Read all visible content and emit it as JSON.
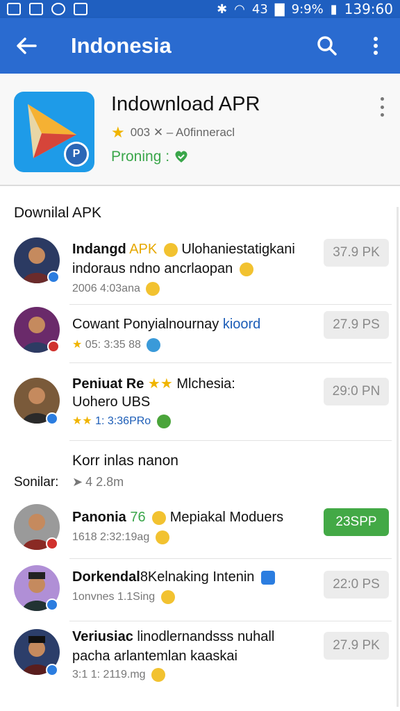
{
  "status_bar": {
    "icons_left": [
      "ha",
      "notify",
      "camera",
      "mail"
    ],
    "battery": "9:9%",
    "signal_text": "43",
    "time": "139:60"
  },
  "app_bar": {
    "back_icon": "arrow-left-icon",
    "title": "Indonesia",
    "search_icon": "search-icon",
    "more_icon": "more-vert-icon"
  },
  "app_card": {
    "logo_badge": "P",
    "name": "Indownload APR",
    "rating_text": "003 ✕ – A0finneracl",
    "status_text": "Proning :",
    "status_icon": "heart-check-icon"
  },
  "list": {
    "section_title": "Downilal APK",
    "mid_label": "Korr inlas nanon",
    "mid_side_label": "Sonilar:",
    "mid_meta": "4 2.8m",
    "rows": [
      {
        "title_bold": "Indangd",
        "title_accent": "APK",
        "title_rest": "Ulohaniestatigkani",
        "line2": "indoraus ndno ancrlaopan",
        "line3": "2006 4:03ana",
        "size": "37.9 PK",
        "active": false
      },
      {
        "title_bold": "Cowant",
        "title_accent": "Ponyialnournay",
        "title_rest": "kioord",
        "line2": "",
        "line3": "05: 3:35 88",
        "size": "27.9 PS",
        "active": false
      },
      {
        "title_bold": "Peniuat Re",
        "title_accent": "",
        "title_rest": "Mlchesia:",
        "line2": "Uohero UBS",
        "line3": "1: 3:36PRo",
        "size": "29:0 PN",
        "active": false
      },
      {
        "title_bold": "Panonia",
        "title_accent": "76",
        "title_rest": "Mepiakal Moduers",
        "line2": "",
        "line3": "1618 2:32:19ag",
        "size": "23SPP",
        "active": true
      },
      {
        "title_bold": "Dorkendal",
        "title_accent": "",
        "title_rest": "8Kelnaking Intenin",
        "line2": "",
        "line3": "1onvnes 1.1Sing",
        "size": "22:0 PS",
        "active": false
      },
      {
        "title_bold": "Veriusiac",
        "title_accent": "",
        "title_rest": "linodlernandsss nuhall",
        "line2": "pacha arlantemlan kaaskai",
        "line3": "3:1 1: 2119.mg",
        "size": "27.9 PK",
        "active": false
      }
    ]
  },
  "colors": {
    "app_bar": "#2a6bd0",
    "status_bar": "#1f5fc0",
    "active_button": "#43a946",
    "status_green": "#3aa64a"
  }
}
